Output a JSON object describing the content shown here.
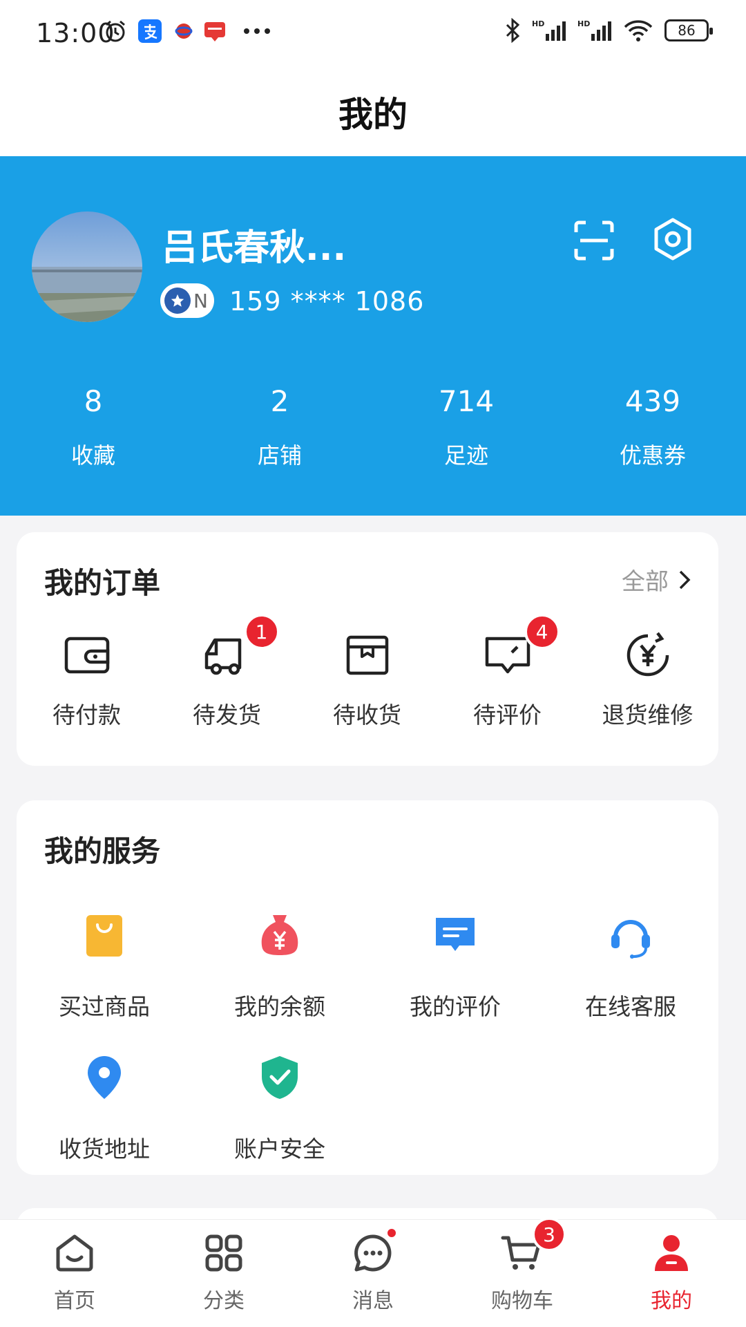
{
  "status_bar": {
    "time": "13:00",
    "battery": "86",
    "icons": [
      "alarm-icon",
      "alipay-icon",
      "globe-app-icon",
      "news-app-icon",
      "more-dots-icon",
      "bluetooth-icon",
      "signal-hd-icon",
      "signal-hd-icon",
      "wifi-icon",
      "battery-icon"
    ]
  },
  "header": {
    "title": "我的"
  },
  "profile": {
    "username": "吕氏春秋...",
    "level": "N",
    "phone": "159  **** 1086",
    "stats": [
      {
        "value": "8",
        "label": "收藏"
      },
      {
        "value": "2",
        "label": "店铺"
      },
      {
        "value": "714",
        "label": "足迹"
      },
      {
        "value": "439",
        "label": "优惠券"
      }
    ]
  },
  "orders": {
    "title": "我的订单",
    "see_all": "全部",
    "items": [
      {
        "label": "待付款",
        "icon": "wallet-icon",
        "badge": ""
      },
      {
        "label": "待发货",
        "icon": "truck-icon",
        "badge": "1"
      },
      {
        "label": "待收货",
        "icon": "package-icon",
        "badge": ""
      },
      {
        "label": "待评价",
        "icon": "comment-icon",
        "badge": "4"
      },
      {
        "label": "退货维修",
        "icon": "refund-icon",
        "badge": ""
      }
    ]
  },
  "services": {
    "title": "我的服务",
    "items": [
      {
        "label": "买过商品",
        "icon": "shopping-bag-icon",
        "color": "#f7b733"
      },
      {
        "label": "我的余额",
        "icon": "money-bag-icon",
        "color": "#f0525e"
      },
      {
        "label": "我的评价",
        "icon": "message-icon",
        "color": "#2f8af0"
      },
      {
        "label": "在线客服",
        "icon": "headset-icon",
        "color": "#2f8af0"
      },
      {
        "label": "收货地址",
        "icon": "location-icon",
        "color": "#2f8af0"
      },
      {
        "label": "账户安全",
        "icon": "shield-icon",
        "color": "#1fb58f"
      }
    ]
  },
  "nav": {
    "items": [
      {
        "label": "首页",
        "icon": "home-icon"
      },
      {
        "label": "分类",
        "icon": "category-icon"
      },
      {
        "label": "消息",
        "icon": "chat-icon"
      },
      {
        "label": "购物车",
        "icon": "cart-icon",
        "badge": "3"
      },
      {
        "label": "我的",
        "icon": "user-icon"
      }
    ]
  },
  "colors": {
    "brand_blue": "#1aa0e6",
    "accent_red": "#e8242f"
  }
}
